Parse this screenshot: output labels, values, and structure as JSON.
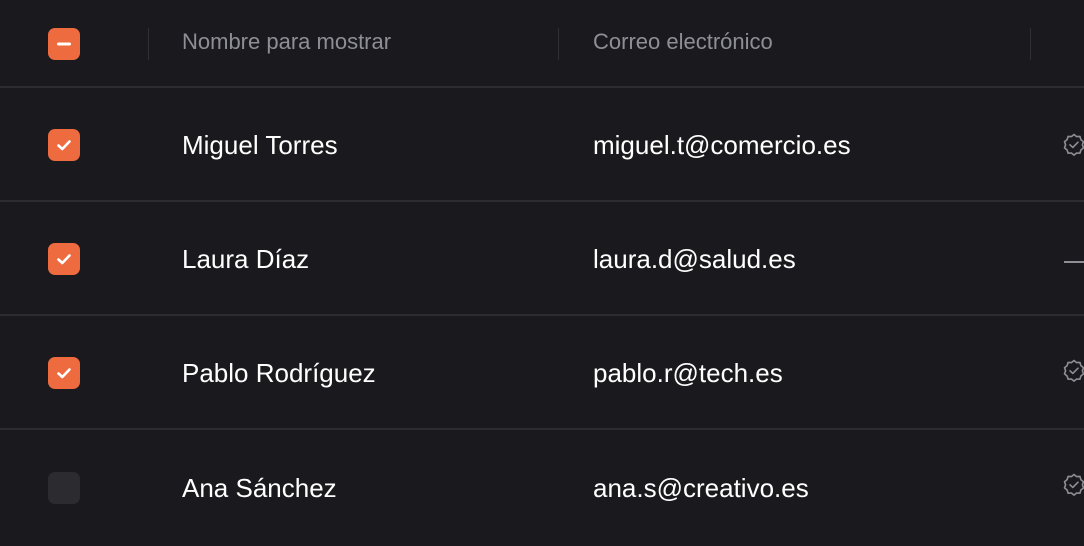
{
  "colors": {
    "accent": "#ee6a3f",
    "background": "#1a1a1e",
    "divider": "#2c2c31",
    "header_text": "#8e8e95",
    "cell_text": "#ffffff",
    "unchecked_box": "#2b2b30"
  },
  "header": {
    "select_all_state": "indeterminate",
    "columns": [
      {
        "label": "Nombre para mostrar"
      },
      {
        "label": "Correo electrónico"
      }
    ]
  },
  "rows": [
    {
      "selected": true,
      "name": "Miguel Torres",
      "email": "miguel.t@comercio.es",
      "status_icon": "verified-badge-icon"
    },
    {
      "selected": true,
      "name": "Laura Díaz",
      "email": "laura.d@salud.es",
      "status_icon": "dash"
    },
    {
      "selected": true,
      "name": "Pablo Rodríguez",
      "email": "pablo.r@tech.es",
      "status_icon": "verified-badge-icon"
    },
    {
      "selected": false,
      "name": "Ana Sánchez",
      "email": "ana.s@creativo.es",
      "status_icon": "verified-badge-icon"
    }
  ]
}
